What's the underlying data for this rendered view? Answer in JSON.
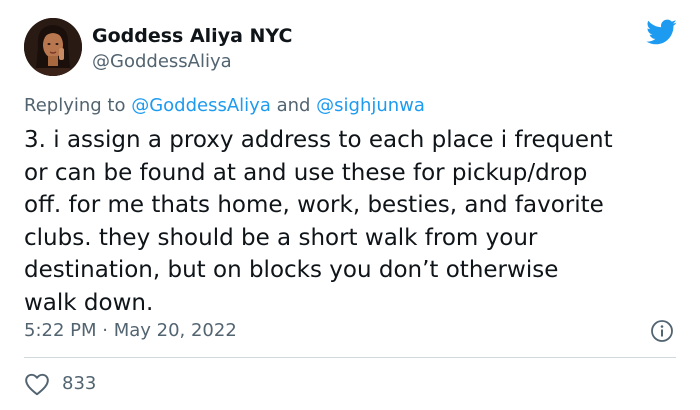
{
  "author": {
    "display_name": "Goddess Aliya NYC",
    "handle": "@GoddessAliya"
  },
  "icons": {
    "brand": "twitter-bird-icon",
    "info": "info-icon",
    "like": "heart-icon"
  },
  "colors": {
    "brand_blue": "#1d9bf0",
    "text_primary": "#0f1419",
    "text_secondary": "#536471",
    "divider": "#cfd9de"
  },
  "reply": {
    "prefix": "Replying to ",
    "mention_1": "@GoddessAliya",
    "conjunction": " and ",
    "mention_2": "@sighjunwa"
  },
  "tweet": {
    "text": "3. i assign a proxy address to each place i frequent\nor can be found at and use these for pickup/drop\noff. for me thats home, work, besties, and favorite\nclubs. they should be a short walk from your\ndestination, but on blocks you don’t otherwise\nwalk down.",
    "timestamp": "5:22 PM · May 20, 2022"
  },
  "engagement": {
    "likes": "833"
  }
}
